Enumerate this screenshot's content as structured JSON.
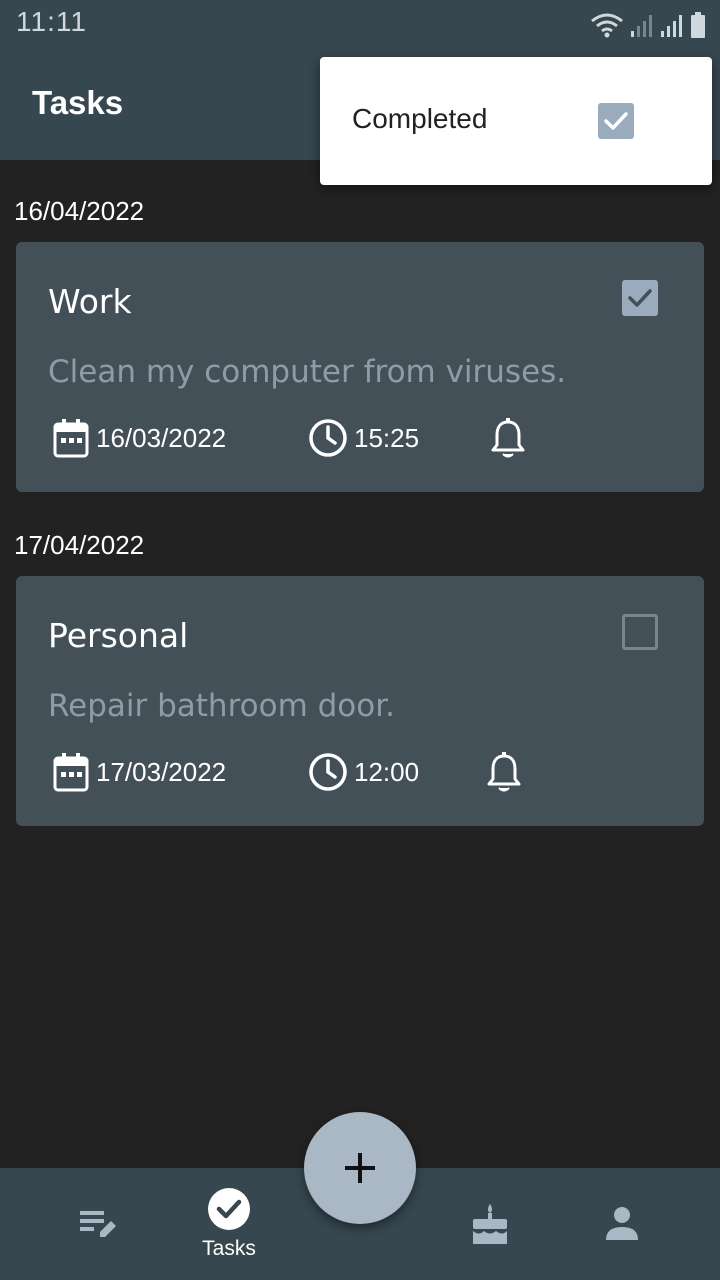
{
  "status_bar": {
    "time": "11:11"
  },
  "app_bar": {
    "title": "Tasks"
  },
  "menu": {
    "items": [
      {
        "label": "Completed",
        "checked": true
      }
    ]
  },
  "groups": [
    {
      "date": "16/04/2022",
      "task": {
        "category": "Work",
        "description": "Clean my computer from viruses.",
        "date": "16/03/2022",
        "time": "15:25",
        "completed": true
      }
    },
    {
      "date": "17/04/2022",
      "task": {
        "category": "Personal",
        "description": "Repair bathroom door.",
        "date": "17/03/2022",
        "time": "12:00",
        "completed": false
      }
    }
  ],
  "bottom_nav": {
    "items": [
      {
        "icon": "notes-icon",
        "label": ""
      },
      {
        "icon": "check-circle-icon",
        "label": "Tasks",
        "active": true
      },
      {
        "icon": "cake-icon",
        "label": ""
      },
      {
        "icon": "person-icon",
        "label": ""
      }
    ]
  },
  "fab": {
    "icon": "plus-icon"
  },
  "colors": {
    "app_bar": "#37474f",
    "background": "#222222",
    "card": "#435058",
    "accent": "#aab8c6"
  }
}
